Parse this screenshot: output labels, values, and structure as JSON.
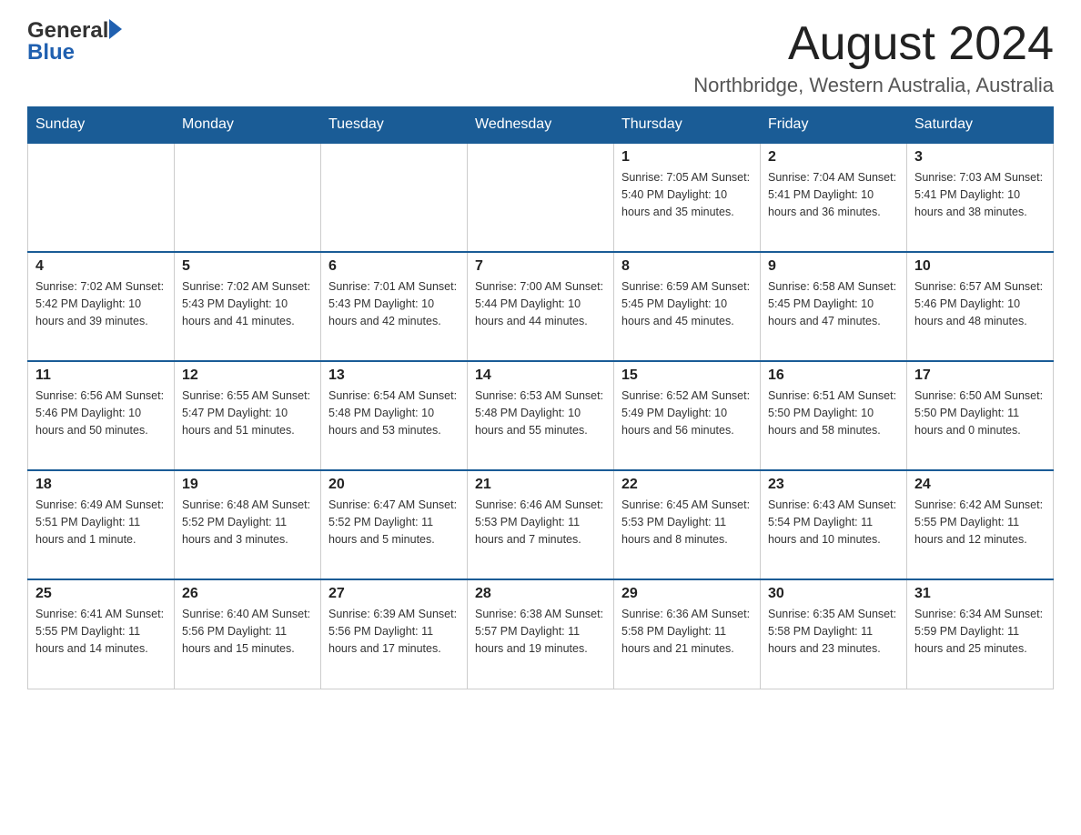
{
  "header": {
    "logo_line1": "General",
    "logo_line2": "Blue",
    "title": "August 2024",
    "subtitle": "Northbridge, Western Australia, Australia"
  },
  "weekdays": [
    "Sunday",
    "Monday",
    "Tuesday",
    "Wednesday",
    "Thursday",
    "Friday",
    "Saturday"
  ],
  "weeks": [
    [
      {
        "day": "",
        "info": ""
      },
      {
        "day": "",
        "info": ""
      },
      {
        "day": "",
        "info": ""
      },
      {
        "day": "",
        "info": ""
      },
      {
        "day": "1",
        "info": "Sunrise: 7:05 AM\nSunset: 5:40 PM\nDaylight: 10 hours\nand 35 minutes."
      },
      {
        "day": "2",
        "info": "Sunrise: 7:04 AM\nSunset: 5:41 PM\nDaylight: 10 hours\nand 36 minutes."
      },
      {
        "day": "3",
        "info": "Sunrise: 7:03 AM\nSunset: 5:41 PM\nDaylight: 10 hours\nand 38 minutes."
      }
    ],
    [
      {
        "day": "4",
        "info": "Sunrise: 7:02 AM\nSunset: 5:42 PM\nDaylight: 10 hours\nand 39 minutes."
      },
      {
        "day": "5",
        "info": "Sunrise: 7:02 AM\nSunset: 5:43 PM\nDaylight: 10 hours\nand 41 minutes."
      },
      {
        "day": "6",
        "info": "Sunrise: 7:01 AM\nSunset: 5:43 PM\nDaylight: 10 hours\nand 42 minutes."
      },
      {
        "day": "7",
        "info": "Sunrise: 7:00 AM\nSunset: 5:44 PM\nDaylight: 10 hours\nand 44 minutes."
      },
      {
        "day": "8",
        "info": "Sunrise: 6:59 AM\nSunset: 5:45 PM\nDaylight: 10 hours\nand 45 minutes."
      },
      {
        "day": "9",
        "info": "Sunrise: 6:58 AM\nSunset: 5:45 PM\nDaylight: 10 hours\nand 47 minutes."
      },
      {
        "day": "10",
        "info": "Sunrise: 6:57 AM\nSunset: 5:46 PM\nDaylight: 10 hours\nand 48 minutes."
      }
    ],
    [
      {
        "day": "11",
        "info": "Sunrise: 6:56 AM\nSunset: 5:46 PM\nDaylight: 10 hours\nand 50 minutes."
      },
      {
        "day": "12",
        "info": "Sunrise: 6:55 AM\nSunset: 5:47 PM\nDaylight: 10 hours\nand 51 minutes."
      },
      {
        "day": "13",
        "info": "Sunrise: 6:54 AM\nSunset: 5:48 PM\nDaylight: 10 hours\nand 53 minutes."
      },
      {
        "day": "14",
        "info": "Sunrise: 6:53 AM\nSunset: 5:48 PM\nDaylight: 10 hours\nand 55 minutes."
      },
      {
        "day": "15",
        "info": "Sunrise: 6:52 AM\nSunset: 5:49 PM\nDaylight: 10 hours\nand 56 minutes."
      },
      {
        "day": "16",
        "info": "Sunrise: 6:51 AM\nSunset: 5:50 PM\nDaylight: 10 hours\nand 58 minutes."
      },
      {
        "day": "17",
        "info": "Sunrise: 6:50 AM\nSunset: 5:50 PM\nDaylight: 11 hours\nand 0 minutes."
      }
    ],
    [
      {
        "day": "18",
        "info": "Sunrise: 6:49 AM\nSunset: 5:51 PM\nDaylight: 11 hours\nand 1 minute."
      },
      {
        "day": "19",
        "info": "Sunrise: 6:48 AM\nSunset: 5:52 PM\nDaylight: 11 hours\nand 3 minutes."
      },
      {
        "day": "20",
        "info": "Sunrise: 6:47 AM\nSunset: 5:52 PM\nDaylight: 11 hours\nand 5 minutes."
      },
      {
        "day": "21",
        "info": "Sunrise: 6:46 AM\nSunset: 5:53 PM\nDaylight: 11 hours\nand 7 minutes."
      },
      {
        "day": "22",
        "info": "Sunrise: 6:45 AM\nSunset: 5:53 PM\nDaylight: 11 hours\nand 8 minutes."
      },
      {
        "day": "23",
        "info": "Sunrise: 6:43 AM\nSunset: 5:54 PM\nDaylight: 11 hours\nand 10 minutes."
      },
      {
        "day": "24",
        "info": "Sunrise: 6:42 AM\nSunset: 5:55 PM\nDaylight: 11 hours\nand 12 minutes."
      }
    ],
    [
      {
        "day": "25",
        "info": "Sunrise: 6:41 AM\nSunset: 5:55 PM\nDaylight: 11 hours\nand 14 minutes."
      },
      {
        "day": "26",
        "info": "Sunrise: 6:40 AM\nSunset: 5:56 PM\nDaylight: 11 hours\nand 15 minutes."
      },
      {
        "day": "27",
        "info": "Sunrise: 6:39 AM\nSunset: 5:56 PM\nDaylight: 11 hours\nand 17 minutes."
      },
      {
        "day": "28",
        "info": "Sunrise: 6:38 AM\nSunset: 5:57 PM\nDaylight: 11 hours\nand 19 minutes."
      },
      {
        "day": "29",
        "info": "Sunrise: 6:36 AM\nSunset: 5:58 PM\nDaylight: 11 hours\nand 21 minutes."
      },
      {
        "day": "30",
        "info": "Sunrise: 6:35 AM\nSunset: 5:58 PM\nDaylight: 11 hours\nand 23 minutes."
      },
      {
        "day": "31",
        "info": "Sunrise: 6:34 AM\nSunset: 5:59 PM\nDaylight: 11 hours\nand 25 minutes."
      }
    ]
  ]
}
